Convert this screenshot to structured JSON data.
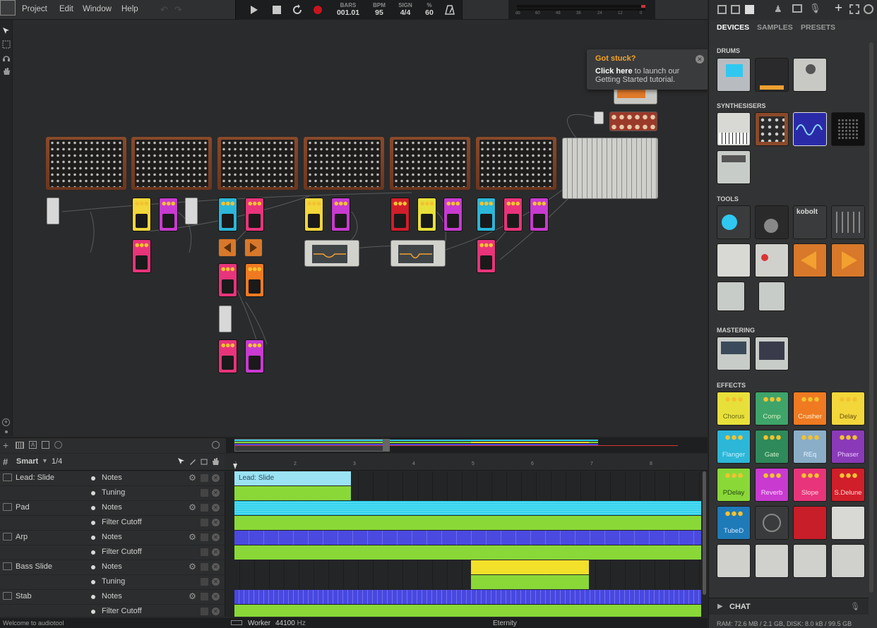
{
  "menu": {
    "items": [
      "Project",
      "Edit",
      "Window",
      "Help"
    ]
  },
  "transport": {
    "bars_label": "BARS",
    "bars_value": "001.01",
    "bpm_label": "BPM",
    "bpm_value": "95",
    "sign_label": "SIGN",
    "sign_value": "4/4",
    "percent_label": "%",
    "percent_value": "60"
  },
  "meter_ticks": [
    "db",
    "60",
    "48",
    "36",
    "24",
    "12",
    "0"
  ],
  "tooltip": {
    "title": "Got stuck?",
    "bold": "Click here",
    "text": " to launch our Getting Started tutorial."
  },
  "timeline": {
    "mode": "Smart",
    "quantize": "1/4",
    "ruler_ticks": [
      "1",
      "2",
      "3",
      "4",
      "5",
      "6",
      "7",
      "8"
    ],
    "tracks": [
      {
        "name": "Lead: Slide",
        "lanes": [
          "Notes",
          "Tuning"
        ],
        "color": "#8ad8f0"
      },
      {
        "name": "Pad",
        "lanes": [
          "Notes",
          "Filter Cutoff"
        ],
        "color": "#2ed0ec"
      },
      {
        "name": "Arp",
        "lanes": [
          "Notes",
          "Filter Cutoff"
        ],
        "color": "#4a4ae0"
      },
      {
        "name": "Bass Slide",
        "lanes": [
          "Notes",
          "Tuning"
        ],
        "color": "#f2e02a"
      },
      {
        "name": "Stab",
        "lanes": [
          "Notes",
          "Filter Cutoff"
        ],
        "color": "#4848e0"
      }
    ],
    "clip_label": "Lead: Slide"
  },
  "status": {
    "message": "Welcome to audiotool",
    "worker": "Worker",
    "sample_rate": "44100",
    "sample_rate_unit": "Hz",
    "song": "Eternity"
  },
  "panel": {
    "tabs": [
      "DEVICES",
      "SAMPLES",
      "PRESETS"
    ],
    "categories": {
      "drums": "DRUMS",
      "synths": "SYNTHESISERS",
      "tools": "TOOLS",
      "mastering": "MASTERING",
      "effects": "EFFECTS"
    },
    "tool_logo": "kobolt",
    "effects": [
      {
        "label": "Chorus",
        "color": "#e8e03a",
        "text": "#6a6a10"
      },
      {
        "label": "Comp",
        "color": "#3ea46a",
        "text": "#d8f0c0"
      },
      {
        "label": "Crusher",
        "color": "#ef7a22",
        "text": "#fff2d0"
      },
      {
        "label": "Delay",
        "color": "#f2d63a",
        "text": "#6a5010"
      },
      {
        "label": "Flanger",
        "color": "#2cb6d8",
        "text": "#c0f0ff"
      },
      {
        "label": "Gate",
        "color": "#2e8a5a",
        "text": "#c8f0c8"
      },
      {
        "label": "REq",
        "color": "#8aaec8",
        "text": "#e8f4ff"
      },
      {
        "label": "Phaser",
        "color": "#8a3ab8",
        "text": "#e8c8ff"
      },
      {
        "label": "PDelay",
        "color": "#8ad838",
        "text": "#234a10"
      },
      {
        "label": "Reverb",
        "color": "#c83ad0",
        "text": "#ffd8ff"
      },
      {
        "label": "Slope",
        "color": "#e8347a",
        "text": "#ffd8e8"
      },
      {
        "label": "S.Delune",
        "color": "#d01e2a",
        "text": "#ffd8d8"
      },
      {
        "label": "TubeD",
        "color": "#1f7ab8",
        "text": "#cfe8ff"
      }
    ],
    "chat": "CHAT",
    "status": "RAM: 72.6 MB / 2.1 GB, DISK: 8.0 kB / 99.5 GB"
  }
}
